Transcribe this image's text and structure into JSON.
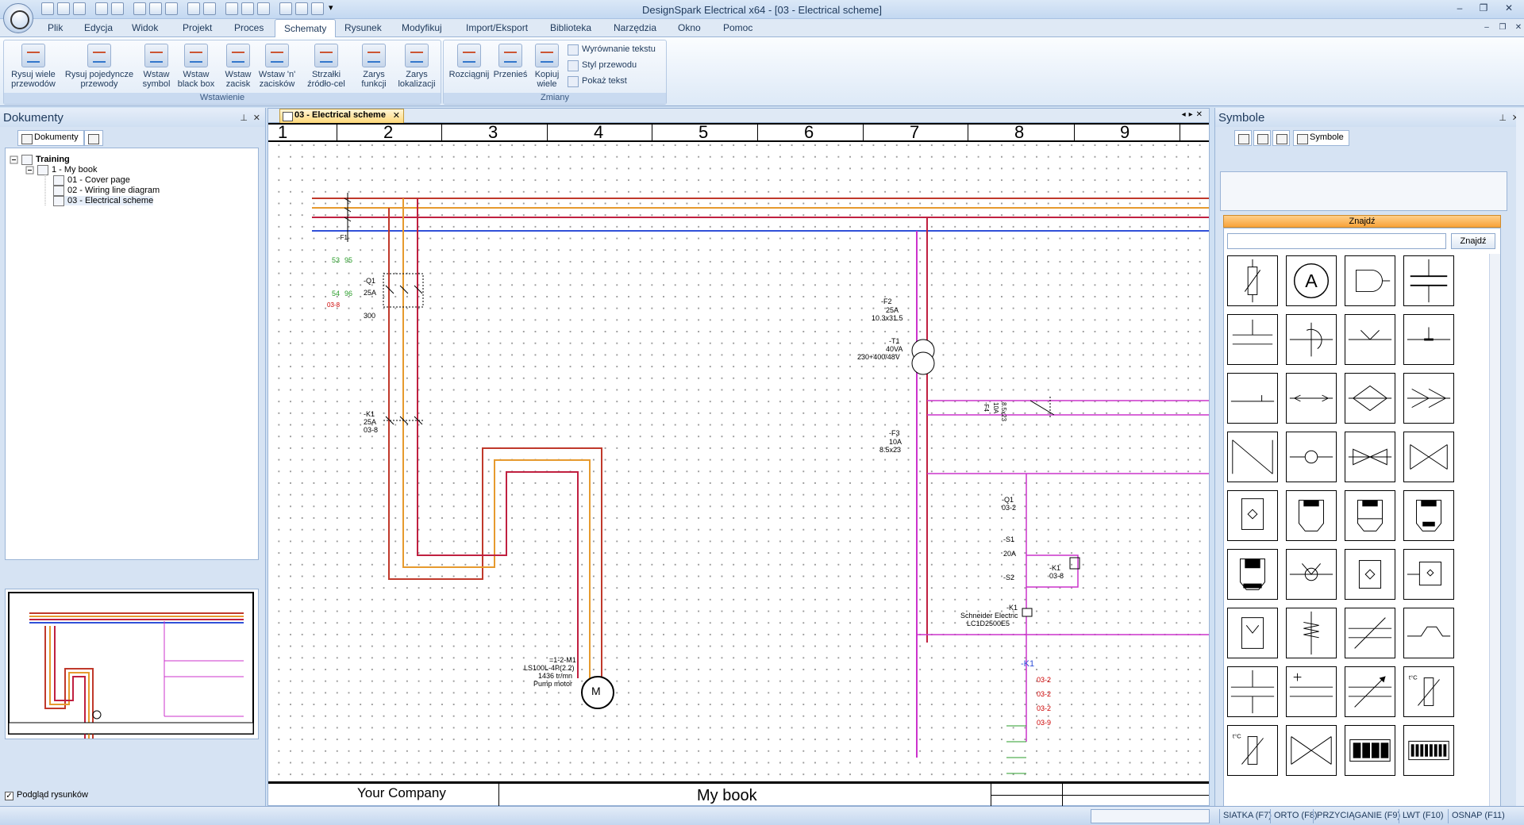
{
  "window": {
    "title": "DesignSpark Electrical x64 - [03 - Electrical scheme]"
  },
  "menu": [
    "Plik",
    "Edycja",
    "Widok",
    "Projekt",
    "Proces",
    "Schematy",
    "Rysunek",
    "Modyfikuj",
    "Import/Eksport",
    "Biblioteka",
    "Narzędzia",
    "Okno",
    "Pomoc"
  ],
  "ribbon": {
    "group_insert": "Wstawienie",
    "group_changes": "Zmiany",
    "draw_multi": "Rysuj wiele przewodów",
    "draw_single": "Rysuj pojedyncze przewody",
    "insert_symbol": "Wstaw symbol",
    "insert_blackbox": "Wstaw black box",
    "insert_terminal": "Wstaw zacisk",
    "insert_n_terminals": "Wstaw 'n' zacisków",
    "arrows": "Strzałki źródło-cel",
    "func_outline": "Zarys funkcji",
    "loc_outline": "Zarys lokalizacji",
    "stretch": "Rozciągnij",
    "move": "Przenieś",
    "copy_many": "Kopiuj wiele",
    "align_text": "Wyrównanie tekstu",
    "wire_style": "Styl przewodu",
    "show_text": "Pokaż tekst"
  },
  "docs": {
    "title": "Dokumenty",
    "tab": "Dokumenty",
    "tree": [
      {
        "label": "Training"
      },
      {
        "label": "1 - My book"
      },
      {
        "label": "01 - Cover page"
      },
      {
        "label": "02 - Wiring line diagram"
      },
      {
        "label": "03 - Electrical scheme"
      }
    ],
    "preview_label": "Podgląd rysunków",
    "preview_checked": "✓"
  },
  "canvas": {
    "tab_label": "03 - Electrical scheme",
    "tab_close": "✕",
    "nav": "◂▸✕",
    "columns": [
      "1",
      "2",
      "3",
      "4",
      "5",
      "6",
      "7",
      "8",
      "9"
    ],
    "company": "Your Company",
    "book": "My book",
    "labels": {
      "f1": "-F1",
      "f1_53": "53",
      "f1_95": "95",
      "f1_54": "54",
      "f1_96": "96",
      "f1_ref": "03-8",
      "q1": "-Q1",
      "q1_rating": "25A",
      "q1_300": "300",
      "k1": "-K1",
      "k1_rating": "25A",
      "k1_ref": "03-8",
      "f2": "-F2",
      "f2_rating": "25A",
      "f2_spec": "10.3x31.5",
      "t1": "-T1",
      "t1_va": "40VA",
      "t1_v": "230+400/48V",
      "f3": "-F3",
      "f3_rating": "10A",
      "f3_spec": "8.5x23",
      "f4": "-F4",
      "f4_rating": "10A",
      "f4_spec": "8.5x23",
      "q1b": "-Q1",
      "q1b_ref": "03-2",
      "s1": "-S1",
      "s1_rating": "20A",
      "s2": "-S2",
      "k1b": "-K1",
      "k1b_ref": "03-8",
      "k1c": "-K1",
      "k1c_maker": "Schneider Electric",
      "k1c_part": "LC1D2500E5",
      "k1_xref": "-K1",
      "m1": "=1-2-M1",
      "m1_model": "LS100L-4P(2.2)",
      "m1_speed": "1436 tr/mn",
      "m1_desc": "Pump motor",
      "m1_sym": "M",
      "xr1": "03-2",
      "xr2": "03-2",
      "xr3": "03-2",
      "xr4": "03-9"
    }
  },
  "symbols": {
    "title": "Symbole",
    "tab": "Symbole",
    "find_header": "Znajdź",
    "search_value": "",
    "find_button": "Znajdź",
    "cell_a": "A",
    "temp_a": "t°C",
    "temp_b": "t°C"
  },
  "status": [
    "SIATKA (F7)",
    "ORTO (F8)",
    "PRZYCIĄGANIE (F9)",
    "LWT (F10)",
    "OSNAP (F11)"
  ],
  "colors": {
    "l1": "#c0392b",
    "l2": "#e69a2e",
    "l3": "#c02040",
    "neutral": "#3050d8",
    "control": "#cc33cc"
  }
}
